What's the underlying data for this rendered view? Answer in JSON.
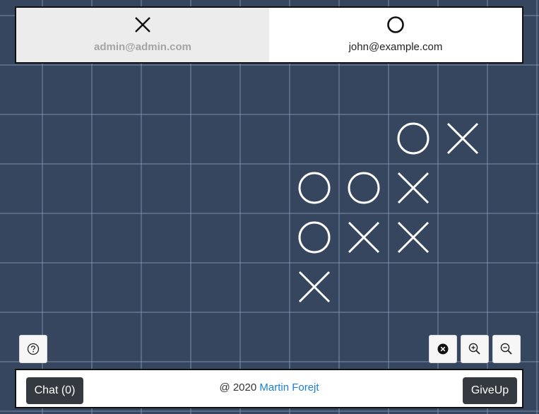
{
  "players": [
    {
      "symbol": "X",
      "email": "admin@admin.com",
      "active": true
    },
    {
      "symbol": "O",
      "email": "john@example.com",
      "active": false
    }
  ],
  "board": {
    "moves": [
      {
        "col": 4,
        "row": 0,
        "symbol": "O"
      },
      {
        "col": 5,
        "row": 0,
        "symbol": "X"
      },
      {
        "col": 2,
        "row": 1,
        "symbol": "O"
      },
      {
        "col": 3,
        "row": 1,
        "symbol": "O"
      },
      {
        "col": 4,
        "row": 1,
        "symbol": "X"
      },
      {
        "col": 2,
        "row": 2,
        "symbol": "O"
      },
      {
        "col": 3,
        "row": 2,
        "symbol": "X"
      },
      {
        "col": 4,
        "row": 2,
        "symbol": "X"
      },
      {
        "col": 2,
        "row": 3,
        "symbol": "X"
      }
    ]
  },
  "toolbar": {
    "help_icon": "question-circle-icon",
    "close_icon": "x-circle-icon",
    "zoom_in_icon": "zoom-in-icon",
    "zoom_out_icon": "zoom-out-icon"
  },
  "footer": {
    "chat_label": "Chat (0)",
    "copyright_prefix": "@ 2020",
    "author": "Martin Forejt",
    "giveup_label": "GiveUp"
  },
  "colors": {
    "background": "#36465f",
    "mark": "#ffffff",
    "link": "#1a7fd6",
    "dark_button": "#343a40"
  }
}
